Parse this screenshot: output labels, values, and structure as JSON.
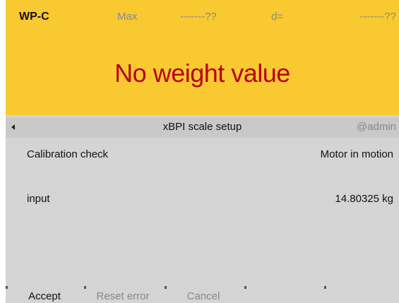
{
  "header": {
    "device_name": "WP-C",
    "max_label": "Max",
    "max_value": "-------??",
    "d_label": "d=",
    "d_value": "-------??",
    "weight_message": "No weight value",
    "background_color": "#f9c932",
    "message_color": "#b8001a"
  },
  "title_bar": {
    "back_icon": "left-arrow-icon",
    "title": "xBPI scale setup",
    "user": "@admin"
  },
  "content": {
    "rows": [
      {
        "label": "Calibration check",
        "value": "Motor in motion"
      },
      {
        "label": "input",
        "value": "14.80325 kg"
      }
    ]
  },
  "softkeys": [
    {
      "label": "Accept",
      "enabled": true
    },
    {
      "label": "Reset error",
      "enabled": false
    },
    {
      "label": "Cancel",
      "enabled": false
    },
    {
      "label": "",
      "enabled": false
    },
    {
      "label": "",
      "enabled": false
    }
  ]
}
